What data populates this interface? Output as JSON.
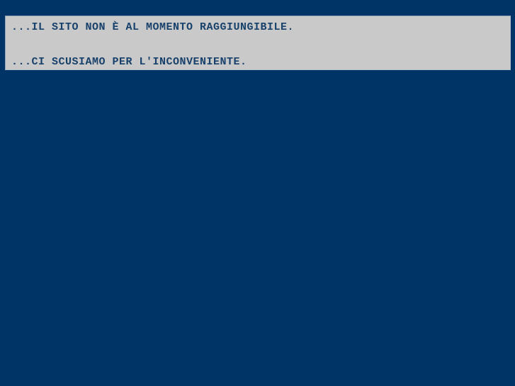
{
  "page": {
    "background_color": "#003366",
    "text_color": "#17406b",
    "panel_color": "#c9c9c9",
    "panel_border_color": "#8ea4bb"
  },
  "notice": {
    "line1": "...IL SITO NON È AL MOMENTO RAGGIUNGIBILE.",
    "line2": "...CI SCUSIAMO PER L'INCONVENIENTE."
  }
}
